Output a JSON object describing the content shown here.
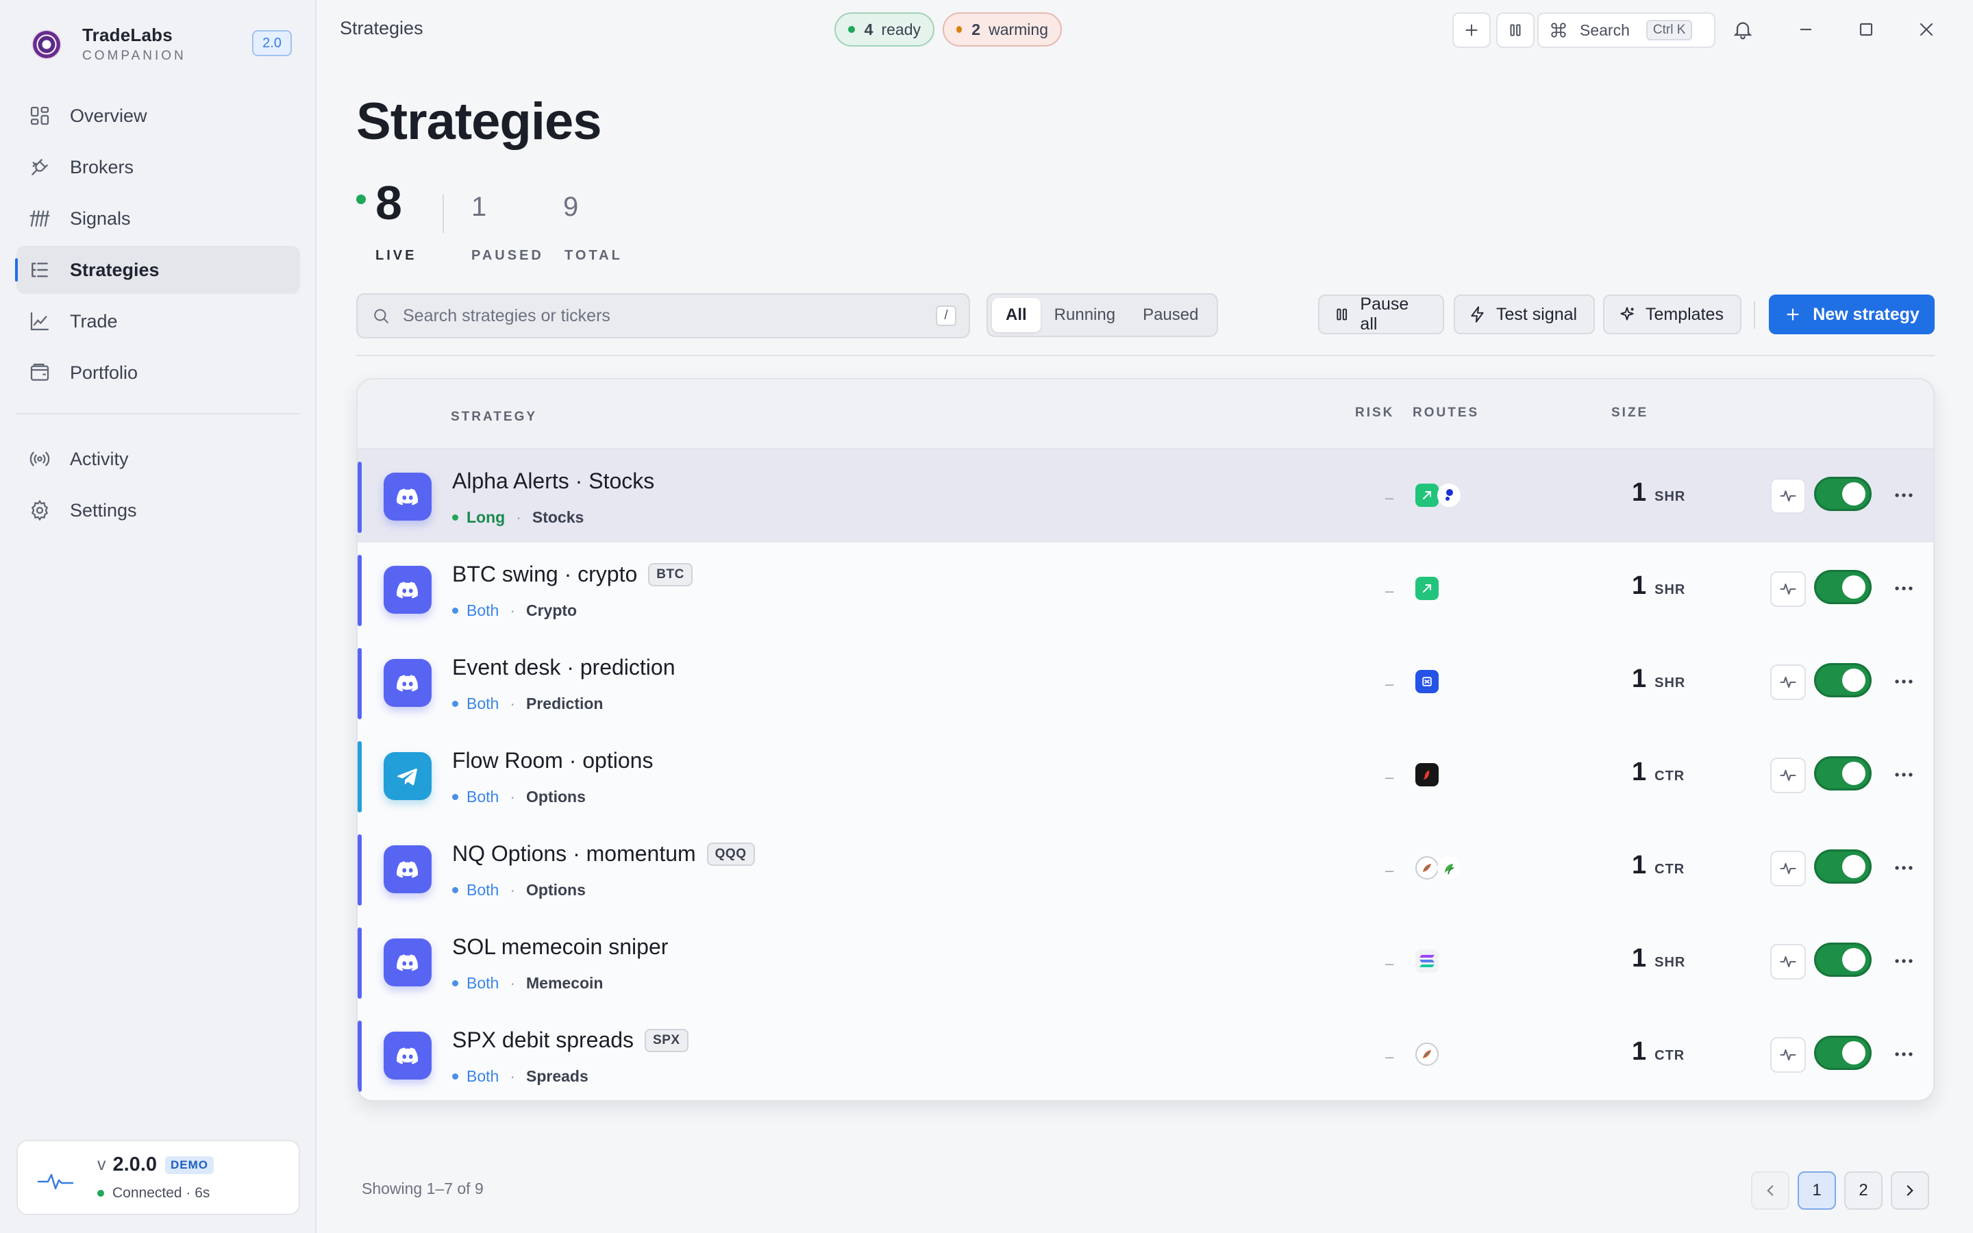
{
  "app": {
    "name": "TradeLabs",
    "subtitle": "COMPANION",
    "version_badge": "2.0"
  },
  "sidebar": {
    "items": [
      {
        "label": "Overview",
        "icon": "grid-icon"
      },
      {
        "label": "Brokers",
        "icon": "plug-icon"
      },
      {
        "label": "Signals",
        "icon": "signal-icon"
      },
      {
        "label": "Strategies",
        "icon": "list-icon",
        "active": true
      },
      {
        "label": "Trade",
        "icon": "chart-icon"
      },
      {
        "label": "Portfolio",
        "icon": "wallet-icon"
      }
    ],
    "secondary": [
      {
        "label": "Activity",
        "icon": "broadcast-icon"
      },
      {
        "label": "Settings",
        "icon": "gear-icon"
      }
    ],
    "version_card": {
      "prefix": "v",
      "version": "2.0.0",
      "badge": "DEMO",
      "status": "Connected · 6s"
    }
  },
  "topbar": {
    "title": "Strategies",
    "ready_count": "4",
    "ready_label": "ready",
    "warming_count": "2",
    "warming_label": "warming",
    "search_label": "Search",
    "search_shortcut": "Ctrl K"
  },
  "page": {
    "title": "Strategies",
    "stats": {
      "live": "8",
      "live_label": "LIVE",
      "paused": "1",
      "paused_label": "PAUSED",
      "total": "9",
      "total_label": "TOTAL"
    },
    "search": {
      "placeholder": "Search strategies or tickers",
      "shortcut": "/"
    },
    "filters": [
      "All",
      "Running",
      "Paused"
    ],
    "actions": {
      "pause_all": "Pause all",
      "test_signal": "Test signal",
      "templates": "Templates",
      "new_strategy": "New strategy"
    }
  },
  "table": {
    "headers": {
      "strategy": "STRATEGY",
      "risk": "RISK",
      "routes": "ROUTES",
      "size": "SIZE"
    },
    "rows": [
      {
        "name": "Alpha Alerts · Stocks",
        "ticker": "",
        "direction": "Long",
        "market": "Stocks",
        "risk": "–",
        "size": "1",
        "unit": "SHR",
        "source": "discord"
      },
      {
        "name": "BTC swing · crypto",
        "ticker": "BTC",
        "direction": "Both",
        "market": "Crypto",
        "risk": "–",
        "size": "1",
        "unit": "SHR",
        "source": "discord"
      },
      {
        "name": "Event desk · prediction",
        "ticker": "",
        "direction": "Both",
        "market": "Prediction",
        "risk": "–",
        "size": "1",
        "unit": "SHR",
        "source": "discord"
      },
      {
        "name": "Flow Room · options",
        "ticker": "",
        "direction": "Both",
        "market": "Options",
        "risk": "–",
        "size": "1",
        "unit": "CTR",
        "source": "telegram"
      },
      {
        "name": "NQ Options · momentum",
        "ticker": "QQQ",
        "direction": "Both",
        "market": "Options",
        "risk": "–",
        "size": "1",
        "unit": "CTR",
        "source": "discord"
      },
      {
        "name": "SOL memecoin sniper",
        "ticker": "",
        "direction": "Both",
        "market": "Memecoin",
        "risk": "–",
        "size": "1",
        "unit": "SHR",
        "source": "discord"
      },
      {
        "name": "SPX debit spreads",
        "ticker": "SPX",
        "direction": "Both",
        "market": "Spreads",
        "risk": "–",
        "size": "1",
        "unit": "CTR",
        "source": "discord"
      }
    ]
  },
  "footer": {
    "showing": "Showing 1–7 of 9",
    "pages": [
      "1",
      "2"
    ],
    "current_page": "1"
  },
  "colors": {
    "accent": "#1f6fe5",
    "discord": "#5865f2",
    "telegram": "#229ed9",
    "live": "#1fa85a",
    "toggle_on": "#1d8f47"
  }
}
